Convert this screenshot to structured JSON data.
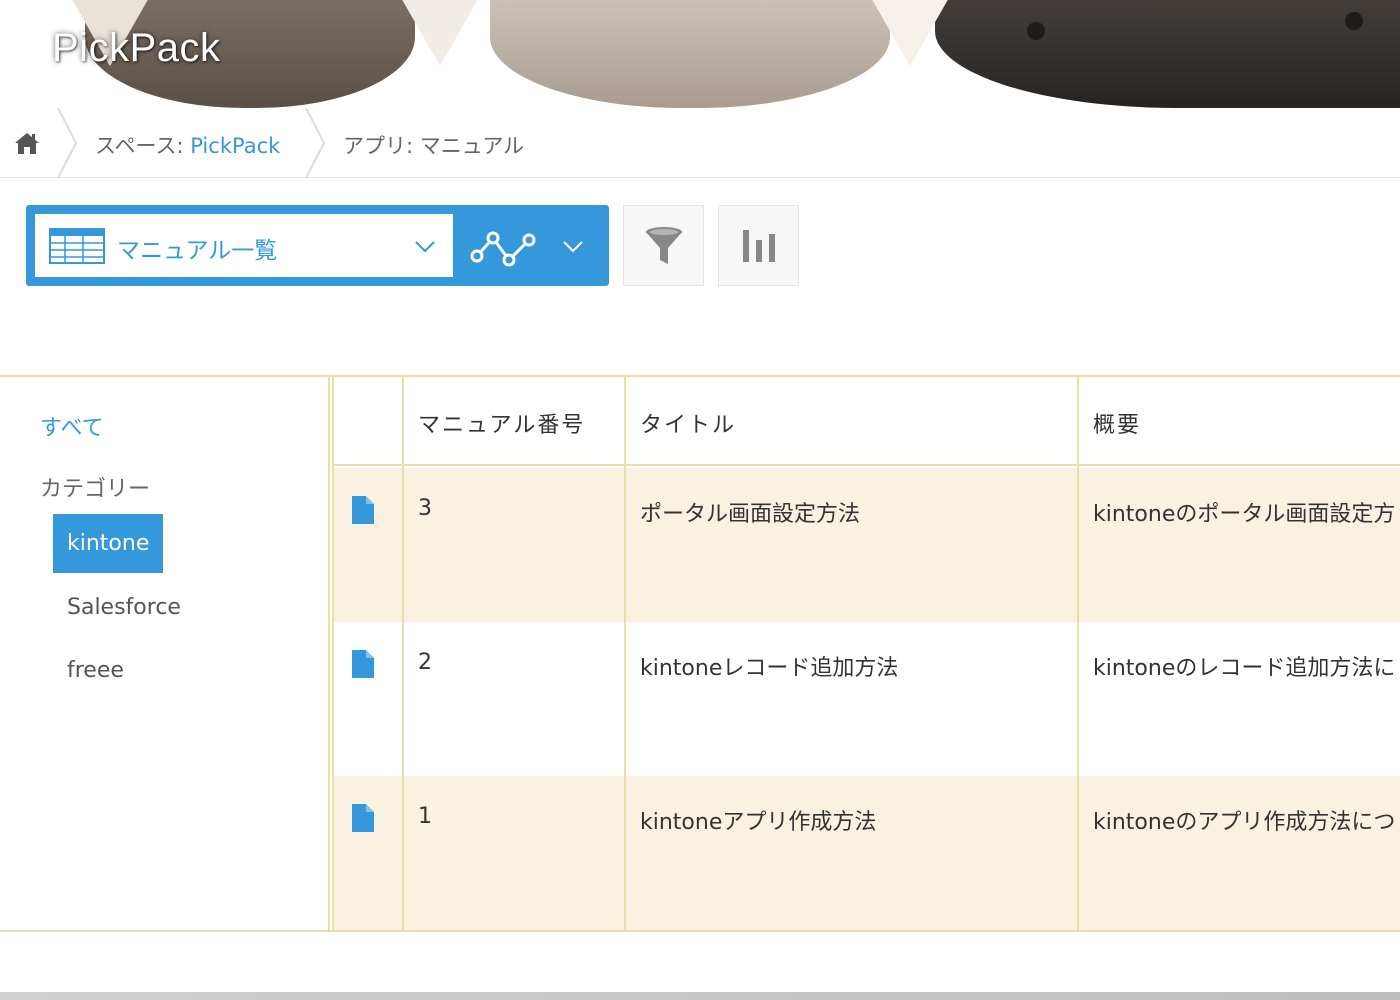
{
  "header": {
    "app_title": "PickPack"
  },
  "breadcrumb": {
    "home_icon": "home-icon",
    "space_prefix": "スペース: ",
    "space_name": "PickPack",
    "app_label": "アプリ: マニュアル"
  },
  "toolbar": {
    "view_icon": "table-grid-icon",
    "view_name": "マニュアル一覧",
    "graph_icon": "line-graph-icon",
    "filter_icon": "filter-funnel-icon",
    "chart_icon": "bar-chart-icon"
  },
  "sidebar": {
    "all_label": "すべて",
    "category_label": "カテゴリー",
    "items": [
      {
        "label": "kintone",
        "active": true
      },
      {
        "label": "Salesforce",
        "active": false
      },
      {
        "label": "freee",
        "active": false
      }
    ]
  },
  "table": {
    "headers": [
      "",
      "マニュアル番号",
      "タイトル",
      "概要"
    ],
    "rows": [
      {
        "number": "3",
        "title": "ポータル画面設定方法",
        "summary": "kintoneのポータル画面設定方"
      },
      {
        "number": "2",
        "title": "kintoneレコード追加方法",
        "summary": "kintoneのレコード追加方法に"
      },
      {
        "number": "1",
        "title": "kintoneアプリ作成方法",
        "summary": "kintoneのアプリ作成方法につ"
      }
    ],
    "row_icon": "document-icon"
  },
  "colors": {
    "accent": "#3498db",
    "row_highlight": "#f9f2e0",
    "table_border": "#e8dfa8"
  }
}
